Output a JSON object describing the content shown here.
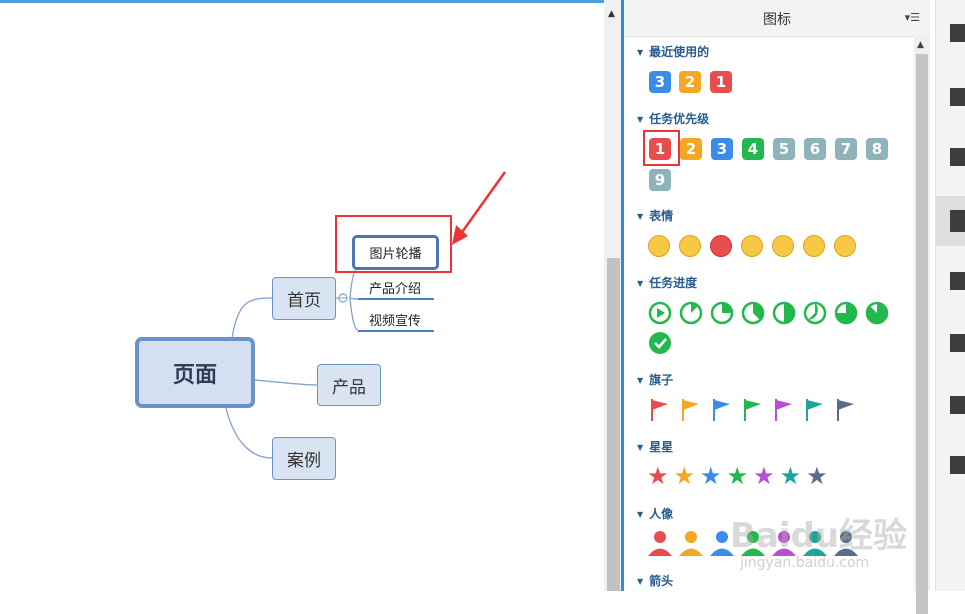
{
  "mindmap": {
    "root": "页面",
    "branches": [
      "首页",
      "产品",
      "案例"
    ],
    "leaves": [
      "图片轮播",
      "产品介绍",
      "视频宣传"
    ]
  },
  "panel": {
    "title": "图标",
    "menu_icon": "sort-list-icon",
    "sections": {
      "recent": {
        "title": "最近使用的",
        "items": [
          "3",
          "2",
          "1"
        ]
      },
      "priority": {
        "title": "任务优先级",
        "items": [
          "1",
          "2",
          "3",
          "4",
          "5",
          "6",
          "7",
          "8",
          "9"
        ]
      },
      "emotion": {
        "title": "表情"
      },
      "progress": {
        "title": "任务进度"
      },
      "flags": {
        "title": "旗子"
      },
      "stars": {
        "title": "星星"
      },
      "people": {
        "title": "人像"
      },
      "arrows": {
        "title": "箭头"
      }
    }
  },
  "colors": {
    "p1": "#e84c4c",
    "p2": "#f5a623",
    "p3": "#3b8beb",
    "p4": "#22b84d",
    "p_gray": "#8fb3bb",
    "progress": "#22b84d",
    "annotation": "#e33333",
    "accent": "#2d8ed8"
  },
  "toolbar": {
    "icons": [
      "structure-icon",
      "style-brush-icon",
      "image-icon",
      "flag-icon",
      "outline-icon",
      "note-icon",
      "comment-icon",
      "task-icon"
    ],
    "active": "flag-icon"
  },
  "watermark": {
    "brand": "Baidu经验",
    "url": "jingyan.baidu.com"
  }
}
